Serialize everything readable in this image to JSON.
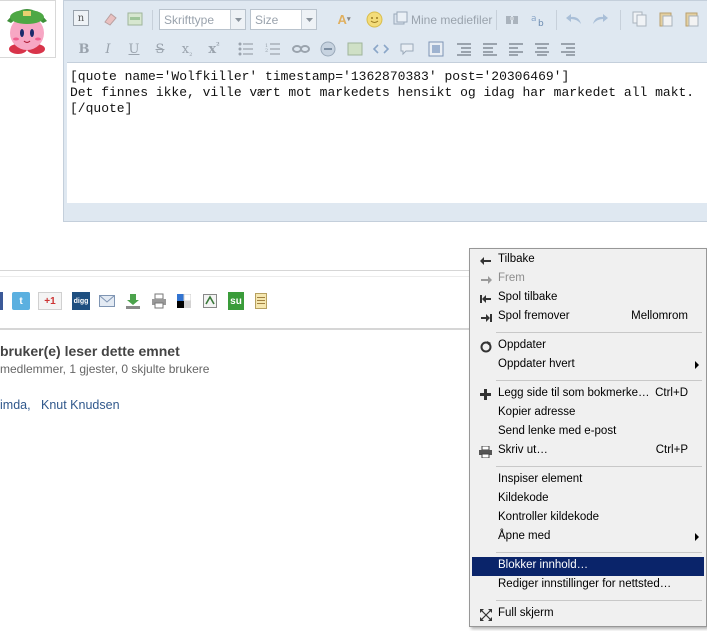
{
  "editor": {
    "font_select": "Skrifttype",
    "size_select": "Size",
    "media_button": "Mine mediefiler",
    "lines": [
      "[quote name='Wolfkiller' timestamp='1362870383' post='20306469']",
      "Det finnes ikke, ville vært mot markedets hensikt og idag har markedet all makt.",
      "[/quote]"
    ]
  },
  "readers": {
    "title": "bruker(e) leser dette emnet",
    "subtitle": "medlemmer, 1 gjester, 0 skjulte brukere",
    "users": [
      "imda,",
      "Knut Knudsen"
    ]
  },
  "share": {
    "gplus": "+1",
    "digg": "digg"
  },
  "context_menu": {
    "items": [
      {
        "label": "Tilbake",
        "shortcut": "",
        "icon": "arrow-left-icon"
      },
      {
        "label": "Frem",
        "shortcut": "",
        "icon": "arrow-right-icon",
        "disabled": true
      },
      {
        "label": "Spol tilbake",
        "shortcut": "",
        "icon": "rewind-icon"
      },
      {
        "label": "Spol fremover",
        "shortcut": "Mellomrom",
        "icon": "fast-forward-icon"
      },
      {
        "label": "Oppdater",
        "shortcut": "",
        "icon": "reload-icon"
      },
      {
        "label": "Oppdater hvert",
        "shortcut": "",
        "submenu": true
      },
      {
        "label": "Legg side til som bokmerke…",
        "shortcut": "Ctrl+D",
        "icon": "plus-icon"
      },
      {
        "label": "Kopier adresse",
        "shortcut": ""
      },
      {
        "label": "Send lenke med e-post",
        "shortcut": ""
      },
      {
        "label": "Skriv ut…",
        "shortcut": "Ctrl+P",
        "icon": "printer-icon"
      },
      {
        "label": "Inspiser element",
        "shortcut": ""
      },
      {
        "label": "Kildekode",
        "shortcut": ""
      },
      {
        "label": "Kontroller kildekode",
        "shortcut": ""
      },
      {
        "label": "Åpne med",
        "shortcut": "",
        "submenu": true
      },
      {
        "label": "Blokker innhold…",
        "shortcut": "",
        "highlighted": true
      },
      {
        "label": "Rediger innstillinger for nettsted…",
        "shortcut": ""
      },
      {
        "label": "Full skjerm",
        "shortcut": "",
        "icon": "fullscreen-icon"
      }
    ]
  },
  "colors": {
    "highlight": "#0a246a",
    "link": "#30588c",
    "editor_bg": "#dfe8f1"
  }
}
